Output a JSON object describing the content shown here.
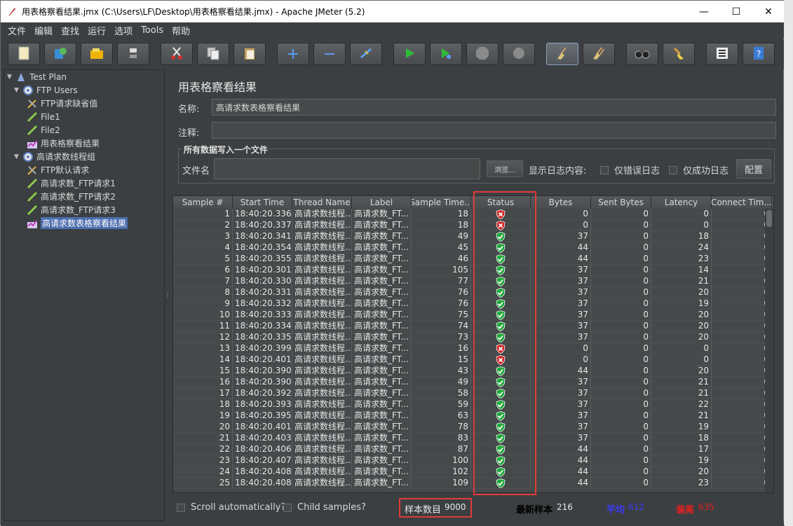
{
  "window": {
    "title": "用表格察看结果.jmx (C:\\Users\\LF\\Desktop\\用表格察看结果.jmx) - Apache JMeter (5.2)",
    "minimize": "—",
    "maximize": "☐",
    "close": "✕"
  },
  "menu": [
    "文件",
    "编辑",
    "查找",
    "运行",
    "选项",
    "Tools",
    "帮助"
  ],
  "toolbar_icons": [
    "new-icon",
    "templates-icon",
    "open-icon",
    "save-icon",
    "cut-icon",
    "copy-icon",
    "paste-icon",
    "expand-icon",
    "collapse-icon",
    "toggle-icon",
    "start-icon",
    "start-no-pause-icon",
    "stop-icon",
    "shutdown-icon",
    "clear-icon",
    "clear-all-icon",
    "search-icon",
    "reset-search-icon",
    "function-helper-icon",
    "help-icon"
  ],
  "tree": [
    {
      "label": "Test Plan",
      "icon": "test-plan-icon",
      "twisty": "▼"
    },
    {
      "label": "FTP Users",
      "icon": "thread-group-icon",
      "twisty": "▼"
    },
    {
      "label": "FTP请求缺省值",
      "icon": "config-wrench-icon",
      "twisty": ""
    },
    {
      "label": "File1",
      "icon": "sampler-pen-icon",
      "twisty": ""
    },
    {
      "label": "File2",
      "icon": "sampler-pen-icon",
      "twisty": ""
    },
    {
      "label": "用表格察看结果",
      "icon": "listener-chart-icon",
      "twisty": ""
    },
    {
      "label": "高请求数线程组",
      "icon": "thread-group-icon",
      "twisty": "▼"
    },
    {
      "label": "FTP默认请求",
      "icon": "config-wrench-icon",
      "twisty": ""
    },
    {
      "label": "高请求数_FTP请求1",
      "icon": "sampler-pen-icon",
      "twisty": ""
    },
    {
      "label": "高请求数_FTP请求2",
      "icon": "sampler-pen-icon",
      "twisty": ""
    },
    {
      "label": "高请求数_FTP请求3",
      "icon": "sampler-pen-icon",
      "twisty": ""
    },
    {
      "label": "高请求数表格察看结果",
      "icon": "listener-chart-icon",
      "twisty": ""
    }
  ],
  "panel": {
    "title": "用表格察看结果",
    "name_label": "名称:",
    "name_value": "高请求数表格察看结果",
    "comment_label": "注释:",
    "comment_value": "",
    "group_title": "所有数据写入一个文件",
    "filename_label": "文件名",
    "filename_value": "",
    "browse_label": "浏览...",
    "log_label": "显示日志内容:",
    "errors_only": "仅错误日志",
    "success_only": "仅成功日志",
    "configure": "配置"
  },
  "table": {
    "columns": [
      "Sample #",
      "Start Time",
      "Thread Name",
      "Label",
      "Sample Time...",
      "Status",
      "Bytes",
      "Sent Bytes",
      "Latency",
      "Connect Tim..."
    ],
    "rows": [
      [
        "1",
        "18:40:20.336",
        "高请求数线程...",
        "高请求数_FT...",
        "18",
        "error",
        "0",
        "0",
        "0",
        "0"
      ],
      [
        "2",
        "18:40:20.337",
        "高请求数线程...",
        "高请求数_FT...",
        "18",
        "error",
        "0",
        "0",
        "0",
        "0"
      ],
      [
        "3",
        "18:40:20.341",
        "高请求数线程...",
        "高请求数_FT...",
        "49",
        "ok",
        "37",
        "0",
        "18",
        "0"
      ],
      [
        "4",
        "18:40:20.354",
        "高请求数线程...",
        "高请求数_FT...",
        "45",
        "ok",
        "44",
        "0",
        "24",
        "0"
      ],
      [
        "5",
        "18:40:20.355",
        "高请求数线程...",
        "高请求数_FT...",
        "46",
        "ok",
        "44",
        "0",
        "23",
        "0"
      ],
      [
        "6",
        "18:40:20.301",
        "高请求数线程...",
        "高请求数_FT...",
        "105",
        "ok",
        "37",
        "0",
        "14",
        "0"
      ],
      [
        "7",
        "18:40:20.330",
        "高请求数线程...",
        "高请求数_FT...",
        "77",
        "ok",
        "37",
        "0",
        "21",
        "0"
      ],
      [
        "8",
        "18:40:20.331",
        "高请求数线程...",
        "高请求数_FT...",
        "76",
        "ok",
        "37",
        "0",
        "20",
        "0"
      ],
      [
        "9",
        "18:40:20.332",
        "高请求数线程...",
        "高请求数_FT...",
        "76",
        "ok",
        "37",
        "0",
        "19",
        "0"
      ],
      [
        "10",
        "18:40:20.333",
        "高请求数线程...",
        "高请求数_FT...",
        "75",
        "ok",
        "37",
        "0",
        "20",
        "0"
      ],
      [
        "11",
        "18:40:20.334",
        "高请求数线程...",
        "高请求数_FT...",
        "74",
        "ok",
        "37",
        "0",
        "20",
        "0"
      ],
      [
        "12",
        "18:40:20.335",
        "高请求数线程...",
        "高请求数_FT...",
        "73",
        "ok",
        "37",
        "0",
        "20",
        "0"
      ],
      [
        "13",
        "18:40:20.399",
        "高请求数线程...",
        "高请求数_FT...",
        "16",
        "error",
        "0",
        "0",
        "0",
        "0"
      ],
      [
        "14",
        "18:40:20.401",
        "高请求数线程...",
        "高请求数_FT...",
        "15",
        "error",
        "0",
        "0",
        "0",
        "0"
      ],
      [
        "15",
        "18:40:20.390",
        "高请求数线程...",
        "高请求数_FT...",
        "43",
        "ok",
        "44",
        "0",
        "20",
        "0"
      ],
      [
        "16",
        "18:40:20.390",
        "高请求数线程...",
        "高请求数_FT...",
        "49",
        "ok",
        "37",
        "0",
        "21",
        "0"
      ],
      [
        "17",
        "18:40:20.392",
        "高请求数线程...",
        "高请求数_FT...",
        "58",
        "ok",
        "37",
        "0",
        "21",
        "0"
      ],
      [
        "18",
        "18:40:20.393",
        "高请求数线程...",
        "高请求数_FT...",
        "59",
        "ok",
        "37",
        "0",
        "22",
        "0"
      ],
      [
        "19",
        "18:40:20.395",
        "高请求数线程...",
        "高请求数_FT...",
        "63",
        "ok",
        "37",
        "0",
        "21",
        "0"
      ],
      [
        "20",
        "18:40:20.401",
        "高请求数线程...",
        "高请求数_FT...",
        "78",
        "ok",
        "37",
        "0",
        "19",
        "0"
      ],
      [
        "21",
        "18:40:20.403",
        "高请求数线程...",
        "高请求数_FT...",
        "83",
        "ok",
        "37",
        "0",
        "18",
        "0"
      ],
      [
        "22",
        "18:40:20.406",
        "高请求数线程...",
        "高请求数_FT...",
        "87",
        "ok",
        "44",
        "0",
        "17",
        "0"
      ],
      [
        "23",
        "18:40:20.407",
        "高请求数线程...",
        "高请求数_FT...",
        "100",
        "ok",
        "44",
        "0",
        "19",
        "0"
      ],
      [
        "24",
        "18:40:20.408",
        "高请求数线程...",
        "高请求数_FT...",
        "102",
        "ok",
        "44",
        "0",
        "20",
        "0"
      ],
      [
        "25",
        "18:40:20.408",
        "高请求数线程...",
        "高请求数_FT...",
        "109",
        "ok",
        "44",
        "0",
        "23",
        "0"
      ]
    ]
  },
  "footer": {
    "scroll_auto": "Scroll automatically?",
    "child_samples": "Child samples?",
    "sample_count_label": "样本数目",
    "sample_count": "9000",
    "latest_label": "最新样本",
    "latest": "216",
    "avg_label": "平均",
    "avg": "612",
    "dev_label": "偏离",
    "dev": "635"
  },
  "colors": {
    "avg": "#3a3aff",
    "dev": "#e02020",
    "highlight": "#e03a3a"
  }
}
